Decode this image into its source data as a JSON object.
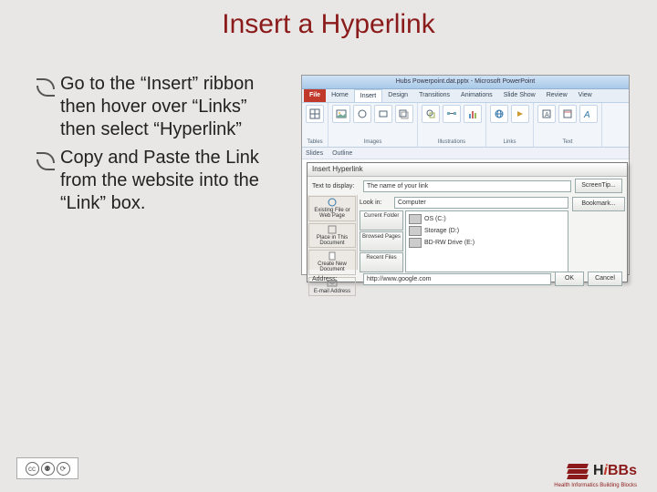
{
  "title": "Insert a Hyperlink",
  "bullets": [
    "Go to the “Insert” ribbon then hover over “Links” then select “Hyperlink”",
    "Copy and Paste the Link from the website into the “Link” box."
  ],
  "screenshot": {
    "window_title": "Hubs Powerpoint.dat.pptx - Microsoft PowerPoint",
    "ribbon_tabs": [
      "File",
      "Home",
      "Insert",
      "Design",
      "Transitions",
      "Animations",
      "Slide Show",
      "Review",
      "View"
    ],
    "active_tab_index": 2,
    "groups": [
      {
        "label": "Tables",
        "icons": [
          "table"
        ]
      },
      {
        "label": "Images",
        "icons": [
          "picture",
          "clipart",
          "screenshot",
          "album"
        ]
      },
      {
        "label": "Illustrations",
        "icons": [
          "shapes",
          "smartart",
          "chart"
        ]
      },
      {
        "label": "Links",
        "icons": [
          "hyperlink",
          "action"
        ]
      },
      {
        "label": "Text",
        "icons": [
          "textbox",
          "header",
          "wordart"
        ]
      }
    ],
    "subbar": [
      "Slides",
      "Outline"
    ]
  },
  "dialog": {
    "title": "Insert Hyperlink",
    "text_to_display_label": "Text to display:",
    "text_to_display_value": "The name of your link",
    "screentip_label": "ScreenTip...",
    "look_in_label": "Look in:",
    "look_in_value": "Computer",
    "side_items": [
      "Existing File or Web Page",
      "Place in This Document",
      "Create New Document",
      "E-mail Address"
    ],
    "browse_items": [
      "Current Folder",
      "Browsed Pages",
      "Recent Files"
    ],
    "drives": [
      "OS (C:)",
      "Storage (D:)",
      "BD-RW Drive (E:)"
    ],
    "bookmark_label": "Bookmark...",
    "address_label": "Address:",
    "address_value": "http://www.google.com",
    "ok": "OK",
    "cancel": "Cancel"
  },
  "footer": {
    "cc": "cc",
    "logo_text_pre": "H",
    "logo_text_i": "i",
    "logo_text_post": "BBs",
    "logo_tagline": "Health Informatics Building Blocks"
  }
}
